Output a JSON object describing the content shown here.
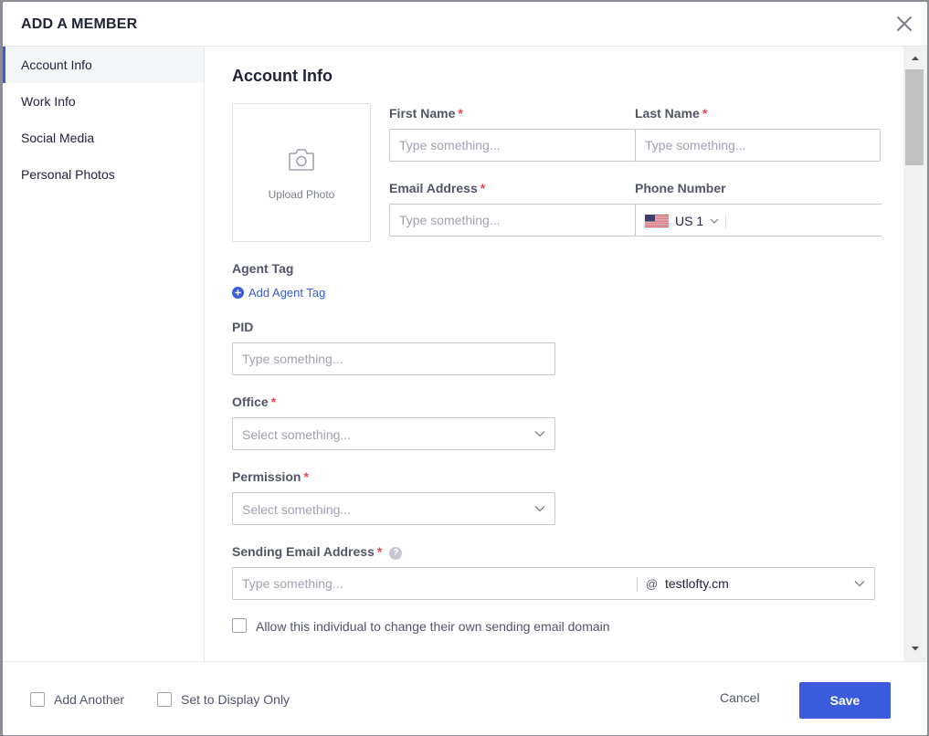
{
  "modal": {
    "title": "ADD A MEMBER"
  },
  "sidebar": {
    "items": [
      {
        "label": "Account Info",
        "active": true
      },
      {
        "label": "Work Info"
      },
      {
        "label": "Social Media"
      },
      {
        "label": "Personal Photos"
      }
    ]
  },
  "account_info": {
    "section_title": "Account Info",
    "upload_photo": "Upload Photo",
    "first_name": {
      "label": "First Name",
      "required_mark": "*",
      "placeholder": "Type something..."
    },
    "last_name": {
      "label": "Last Name",
      "required_mark": "*",
      "placeholder": "Type something..."
    },
    "email": {
      "label": "Email Address",
      "required_mark": "*",
      "placeholder": "Type something..."
    },
    "phone": {
      "label": "Phone Number",
      "country_code": "US 1"
    },
    "agent_tag": {
      "label": "Agent Tag",
      "add_link": "Add Agent Tag"
    },
    "pid": {
      "label": "PID",
      "placeholder": "Type something..."
    },
    "office": {
      "label": "Office",
      "required_mark": "*",
      "placeholder": "Select something..."
    },
    "permission": {
      "label": "Permission",
      "required_mark": "*",
      "placeholder": "Select something..."
    },
    "sending_email": {
      "label": "Sending Email Address",
      "required_mark": "*",
      "help": "?",
      "placeholder": "Type something...",
      "at": "@",
      "domain": "testlofty.cm"
    },
    "allow_domain_change": "Allow this individual to change their own sending email domain"
  },
  "footer": {
    "add_another": "Add Another",
    "display_only": "Set to Display Only",
    "cancel": "Cancel",
    "save": "Save"
  },
  "colors": {
    "accent": "#3a5bdc",
    "required": "#f0454c",
    "text_primary": "#202437",
    "text_label": "#515666",
    "placeholder": "#a0a3af"
  }
}
